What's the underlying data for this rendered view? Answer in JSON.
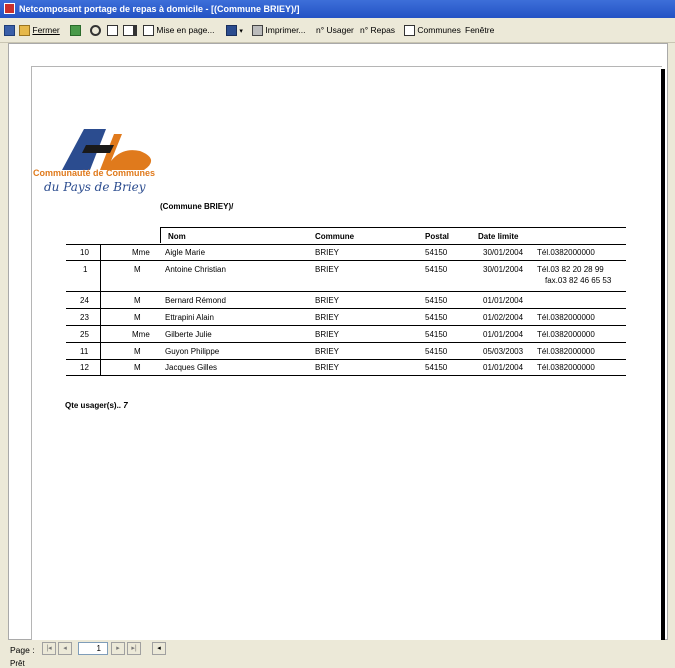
{
  "window": {
    "title": "Netcomposant portage de repas à domicile - [(Commune BRIEY)/]"
  },
  "toolbar": {
    "close_label": "Fermer",
    "page_setup_label": "Mise en page...",
    "print_label": "Imprimer...",
    "user_no_label": "n° Usager",
    "meal_no_label": "n° Repas",
    "communes_label": "Communes",
    "window_label": "Fenêtre"
  },
  "report": {
    "logo_line1": "Communauté de Communes",
    "logo_line2": "du Pays de Briey",
    "commune_header": "(Commune BRIEY)/",
    "columns": {
      "nom": "Nom",
      "commune": "Commune",
      "postal": "Postal",
      "date": "Date limite"
    },
    "rows": [
      {
        "num": "10",
        "civ": "Mme",
        "nom": "Aigle Marie",
        "commune": "BRIEY",
        "postal": "54150",
        "date": "30/01/2004",
        "tel": "Tél.0382000000",
        "tel2": ""
      },
      {
        "num": "1",
        "civ": "M",
        "nom": "Antoine Christian",
        "commune": "BRIEY",
        "postal": "54150",
        "date": "30/01/2004",
        "tel": "Tél.03 82 20 28 99",
        "tel2": "fax.03 82 46 65 53"
      },
      {
        "num": "24",
        "civ": "M",
        "nom": "Bernard Rémond",
        "commune": "BRIEY",
        "postal": "54150",
        "date": "01/01/2004",
        "tel": "",
        "tel2": ""
      },
      {
        "num": "23",
        "civ": "M",
        "nom": "Ettrapini Alain",
        "commune": "BRIEY",
        "postal": "54150",
        "date": "01/02/2004",
        "tel": "Tél.0382000000",
        "tel2": ""
      },
      {
        "num": "25",
        "civ": "Mme",
        "nom": "Gilberte Julie",
        "commune": "BRIEY",
        "postal": "54150",
        "date": "01/01/2004",
        "tel": "Tél.0382000000",
        "tel2": ""
      },
      {
        "num": "11",
        "civ": "M",
        "nom": "Guyon Philippe",
        "commune": "BRIEY",
        "postal": "54150",
        "date": "05/03/2003",
        "tel": "Tél.0382000000",
        "tel2": ""
      },
      {
        "num": "12",
        "civ": "M",
        "nom": "Jacques Gilles",
        "commune": "BRIEY",
        "postal": "54150",
        "date": "01/01/2004",
        "tel": "Tél.0382000000",
        "tel2": ""
      }
    ],
    "summary_label": "Qte usager(s)..",
    "summary_count": "7"
  },
  "statusbar": {
    "page_label": "Page :",
    "page_value": "1",
    "status_text": "Prêt"
  }
}
